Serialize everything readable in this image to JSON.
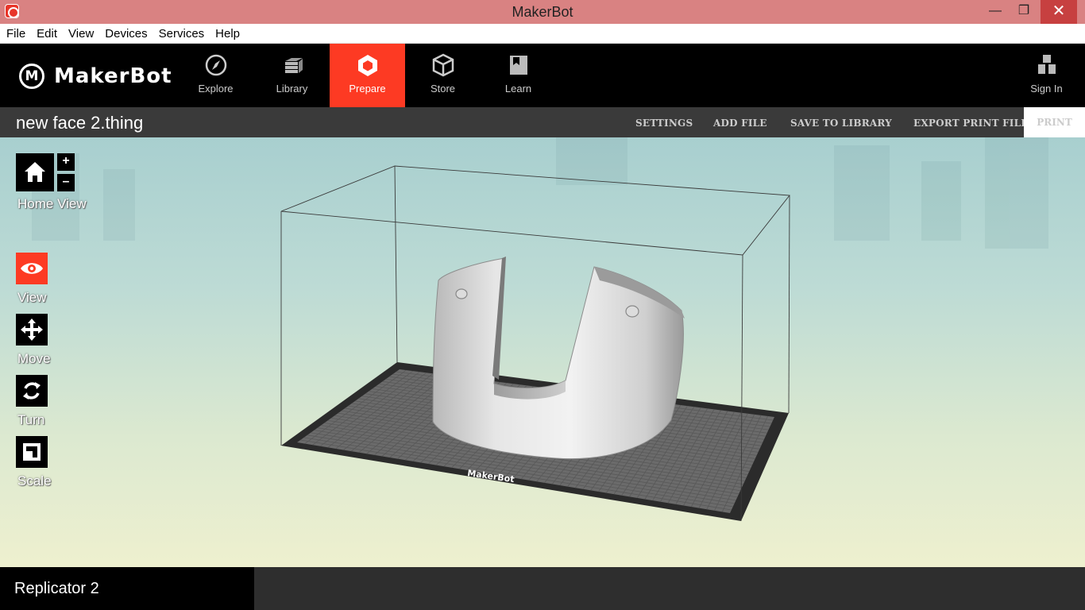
{
  "window": {
    "title": "MakerBot",
    "minimize_label": "—",
    "restore_label": "❐",
    "close_label": "✕"
  },
  "menu": [
    "File",
    "Edit",
    "View",
    "Devices",
    "Services",
    "Help"
  ],
  "nav": {
    "logo_text": "MakerBot",
    "items": [
      {
        "label": "Explore",
        "icon": "compass-icon"
      },
      {
        "label": "Library",
        "icon": "library-icon"
      },
      {
        "label": "Prepare",
        "icon": "prepare-icon",
        "active": true
      },
      {
        "label": "Store",
        "icon": "store-icon"
      },
      {
        "label": "Learn",
        "icon": "learn-icon"
      }
    ],
    "signin_label": "Sign In"
  },
  "toolbar": {
    "file_title": "new face 2.thing",
    "settings_label": "SETTINGS",
    "add_file_label": "ADD FILE",
    "save_label": "SAVE TO LIBRARY",
    "export_label": "EXPORT PRINT FILE",
    "print_label": "PRINT"
  },
  "viewport": {
    "home_view_label": "Home View",
    "zoom_in_label": "+",
    "zoom_out_label": "–",
    "tools": [
      {
        "label": "View",
        "icon": "eye-icon",
        "active": true
      },
      {
        "label": "Move",
        "icon": "move-icon"
      },
      {
        "label": "Turn",
        "icon": "rotate-icon"
      },
      {
        "label": "Scale",
        "icon": "scale-icon"
      }
    ],
    "plate_logo_text": "MakerBot"
  },
  "status": {
    "device_name": "Replicator 2"
  },
  "colors": {
    "accent": "#fd3a23",
    "titlebar": "#d98282",
    "toolbar": "#3a3a3a"
  }
}
